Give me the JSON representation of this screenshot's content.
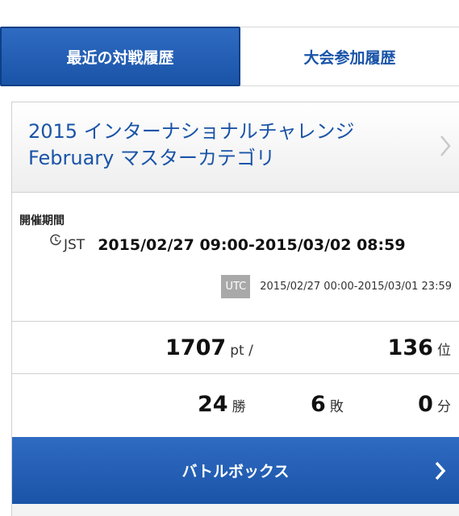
{
  "tabs": {
    "recent": "最近の対戦履歴",
    "tournament": "大会参加履歴"
  },
  "event": {
    "title_line1": "2015 インターナショナルチャレンジ",
    "title_line2": "February マスターカテゴリ"
  },
  "period": {
    "label": "開催期間",
    "jst_label": "JST",
    "jst_range": "2015/02/27 09:00-2015/03/02 08:59",
    "utc_label": "UTC",
    "utc_range": "2015/02/27 00:00-2015/03/01 23:59"
  },
  "stats": {
    "points": "1707",
    "points_unit": "pt /",
    "rank": "136",
    "rank_unit": "位",
    "wins": "24",
    "wins_unit": "勝",
    "losses": "6",
    "losses_unit": "敗",
    "draws": "0",
    "draws_unit": "分"
  },
  "battle_box": {
    "label": "バトルボックス"
  },
  "colors": {
    "brand_blue": "#1a54a8",
    "utc_badge": "#a9a9a9"
  },
  "icons": [
    "clock-icon",
    "chevron-right-icon"
  ]
}
